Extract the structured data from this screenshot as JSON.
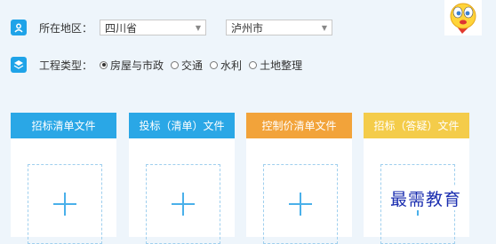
{
  "region": {
    "label": "所在地区：",
    "province": "四川省",
    "city": "泸州市"
  },
  "project_type": {
    "label": "工程类型：",
    "options": [
      {
        "label": "房屋与市政",
        "selected": true
      },
      {
        "label": "交通",
        "selected": false
      },
      {
        "label": "水利",
        "selected": false
      },
      {
        "label": "土地整理",
        "selected": false
      }
    ]
  },
  "cards": [
    {
      "title": "招标清单文件",
      "color": "#2aa7e6"
    },
    {
      "title": "投标（清单）文件",
      "color": "#2aa7e6"
    },
    {
      "title": "控制价清单文件",
      "color": "#f2a33a"
    },
    {
      "title": "招标（答疑）文件",
      "color": "#f4cc4a"
    }
  ],
  "watermark": "最需教育",
  "icons": [
    "location-icon",
    "layers-icon",
    "mascot-icon",
    "plus-icon",
    "chevron-down-icon"
  ]
}
